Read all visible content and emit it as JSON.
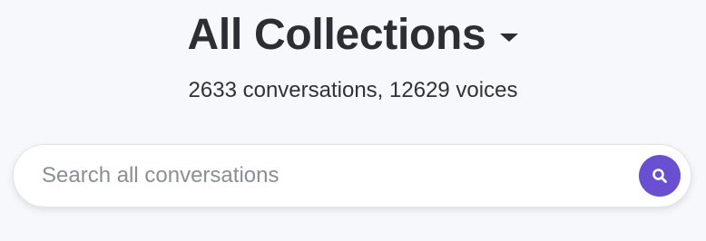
{
  "header": {
    "title": "All Collections",
    "dropdown_icon": "caret-down-icon",
    "subtitle": "2633 conversations, 12629 voices"
  },
  "search": {
    "placeholder": "Search all conversations",
    "value": "",
    "button_icon": "search-icon",
    "button_color": "#6a4fd0"
  }
}
